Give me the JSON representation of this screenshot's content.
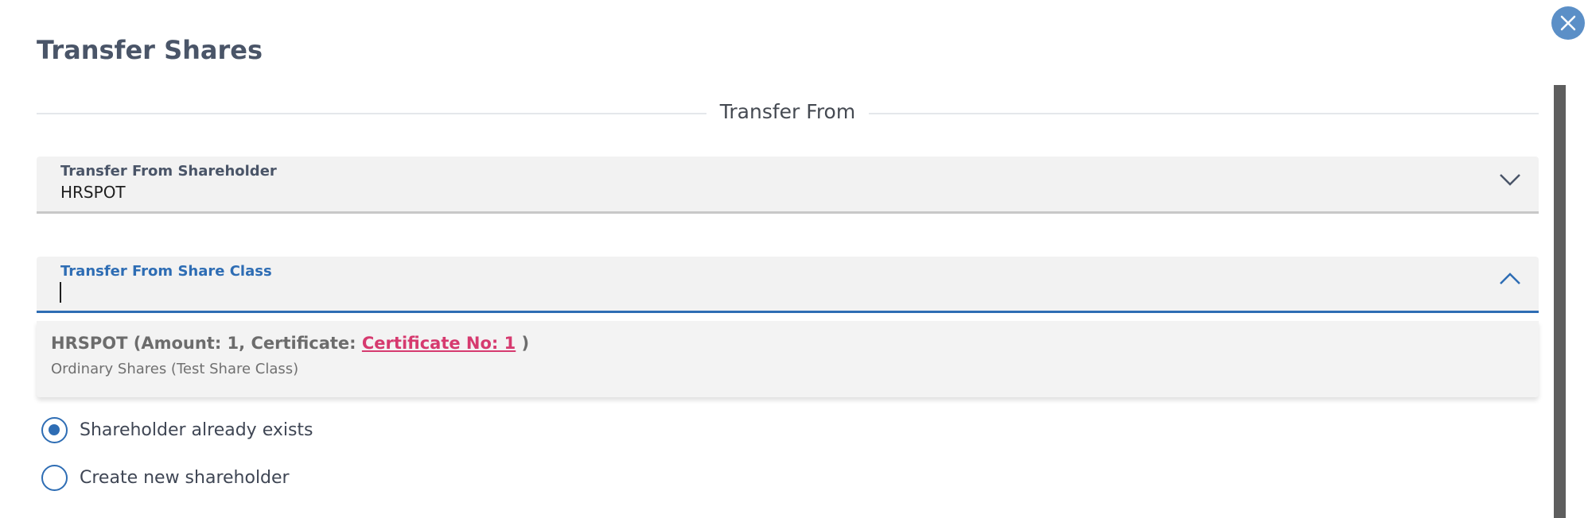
{
  "dialog": {
    "title": "Transfer Shares",
    "close_icon": "close-x"
  },
  "section": {
    "label": "Transfer From"
  },
  "shareholder_field": {
    "label": "Transfer From Shareholder",
    "value": "HRSPOT",
    "state": "collapsed"
  },
  "share_class_field": {
    "label": "Transfer From Share Class",
    "value": "",
    "state": "expanded-focused"
  },
  "dropdown": {
    "options": [
      {
        "prefix": "HRSPOT (Amount: 1, Certificate: ",
        "link_text": "Certificate No: 1",
        "suffix": " )",
        "subtext": "Ordinary Shares (Test Share Class)"
      }
    ]
  },
  "recipient_options": {
    "selected": "existing",
    "existing_label": "Shareholder already exists",
    "new_label": "Create new shareholder"
  },
  "colors": {
    "accent": "#2e6db4",
    "link": "#d63a6f",
    "close_button": "#5b8fc7"
  }
}
